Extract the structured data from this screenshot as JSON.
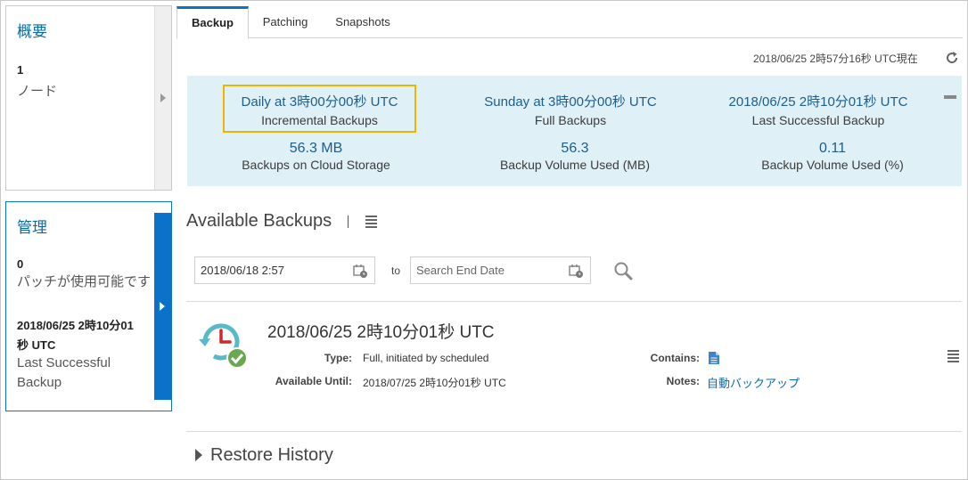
{
  "sidebar": {
    "overview": {
      "title": "概要",
      "count": "1",
      "label": "ノード"
    },
    "management": {
      "title": "管理",
      "patch_count": "0",
      "patch_label": "パッチが使用可能です",
      "last_backup_line1": "2018/06/25 2時10分01",
      "last_backup_line2": "秒 UTC",
      "last_backup_label_line1": "Last Successful",
      "last_backup_label_line2": "Backup"
    }
  },
  "tabs": [
    {
      "label": "Backup",
      "active": true
    },
    {
      "label": "Patching",
      "active": false
    },
    {
      "label": "Snapshots",
      "active": false
    }
  ],
  "as_of": "2018/06/25 2時57分16秒 UTC現在",
  "summary": {
    "incremental": {
      "value": "Daily at 3時00分00秒 UTC",
      "label": "Incremental Backups"
    },
    "full": {
      "value": "Sunday at 3時00分00秒 UTC",
      "label": "Full Backups"
    },
    "last_success": {
      "value": "2018/06/25 2時10分01秒 UTC",
      "label": "Last Successful Backup"
    },
    "cloud_storage": {
      "value": "56.3 MB",
      "label": "Backups on Cloud Storage"
    },
    "volume_mb": {
      "value": "56.3",
      "label": "Backup Volume Used (MB)"
    },
    "volume_pct": {
      "value": "0.11",
      "label": "Backup Volume Used (%)"
    }
  },
  "available_backups": {
    "title": "Available Backups",
    "start_date": "2018/06/18 2:57",
    "to_label": "to",
    "end_placeholder": "Search End Date"
  },
  "backup_entry": {
    "title": "2018/06/25 2時10分01秒 UTC",
    "type_label": "Type:",
    "type_value": "Full, initiated by scheduled",
    "until_label": "Available Until:",
    "until_value": "2018/07/25 2時10分01秒 UTC",
    "contains_label": "Contains:",
    "notes_label": "Notes:",
    "notes_value": "自動バックアップ"
  },
  "restore_history": {
    "label": "Restore History"
  },
  "colors": {
    "accent": "#0b73c9",
    "panel_bg": "#dff0f6",
    "highlight": "#f0b400",
    "success": "#6aa84f"
  },
  "icons": [
    "chevron-right-icon",
    "refresh-icon",
    "collapse-icon",
    "menu-icon",
    "calendar-icon",
    "search-icon",
    "backup-clock-icon",
    "check-icon",
    "document-icon",
    "expand-triangle-icon"
  ]
}
